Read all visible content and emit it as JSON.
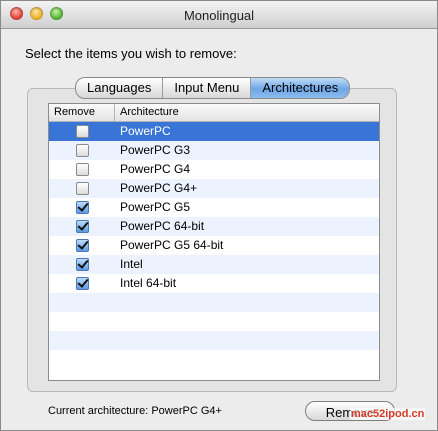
{
  "window": {
    "title": "Monolingual"
  },
  "prompt": "Select the items you wish to remove:",
  "tabs": [
    {
      "label": "Languages",
      "active": false
    },
    {
      "label": "Input Menu",
      "active": false
    },
    {
      "label": "Architectures",
      "active": true
    }
  ],
  "table": {
    "columns": [
      "Remove",
      "Architecture"
    ],
    "rows": [
      {
        "checked": false,
        "label": "PowerPC",
        "selected": true
      },
      {
        "checked": false,
        "label": "PowerPC G3",
        "selected": false
      },
      {
        "checked": false,
        "label": "PowerPC G4",
        "selected": false
      },
      {
        "checked": false,
        "label": "PowerPC G4+",
        "selected": false
      },
      {
        "checked": true,
        "label": "PowerPC G5",
        "selected": false
      },
      {
        "checked": true,
        "label": "PowerPC 64-bit",
        "selected": false
      },
      {
        "checked": true,
        "label": "PowerPC G5 64-bit",
        "selected": false
      },
      {
        "checked": true,
        "label": "Intel",
        "selected": false
      },
      {
        "checked": true,
        "label": "Intel 64-bit",
        "selected": false
      }
    ]
  },
  "status": "Current architecture: PowerPC G4+",
  "remove_label": "Remove",
  "watermark": "mac52ipod.cn",
  "colors": {
    "selection": "#3875d7",
    "active_tab": "#6fa6e6",
    "watermark": "#d43a2a"
  }
}
